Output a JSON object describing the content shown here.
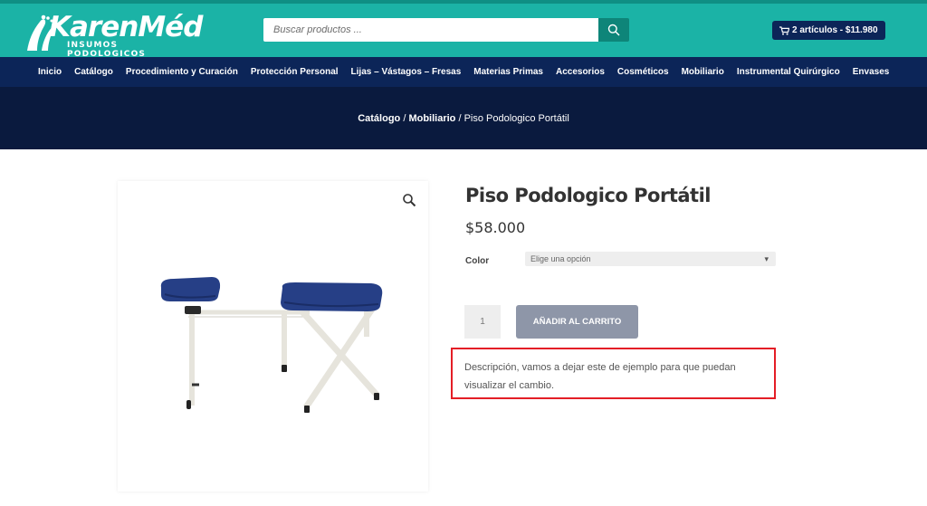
{
  "brand": {
    "name": "KarenMéd",
    "tagline": "INSUMOS PODOLOGICOS"
  },
  "search": {
    "placeholder": "Buscar productos ...",
    "icon": "search-icon"
  },
  "cart": {
    "label": "2 artículos - $11.980",
    "icon": "cart-icon"
  },
  "nav": {
    "items": [
      "Inicio",
      "Catálogo",
      "Procedimiento y Curación",
      "Protección Personal",
      "Lijas – Vástagos – Fresas",
      "Materias Primas",
      "Accesorios",
      "Cosméticos",
      "Mobiliario",
      "Instrumental Quirúrgico",
      "Envases"
    ]
  },
  "breadcrumb": {
    "items": [
      "Catálogo",
      "Mobiliario"
    ],
    "separator": "/",
    "current": "Piso Podologico Portátil"
  },
  "product": {
    "title": "Piso Podologico Portátil",
    "price": "$58.000",
    "color_label": "Color",
    "color_select": "Elige una opción",
    "quantity": "1",
    "add_to_cart": "AÑADIR AL CARRITO",
    "description": "Descripción, vamos a dejar este de ejemplo para que puedan visualizar el cambio."
  },
  "colors": {
    "header": "#1bb3a6",
    "nav": "#0c2558",
    "hero": "#0a1a3e",
    "highlight": "#e41e26",
    "button": "#8e96a8"
  }
}
